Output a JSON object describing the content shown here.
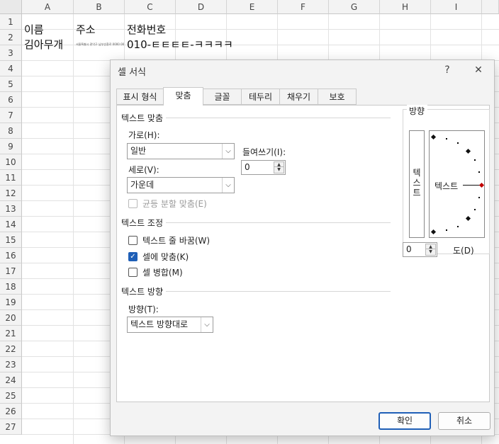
{
  "sheet": {
    "columns": [
      "A",
      "B",
      "C",
      "D",
      "E",
      "F",
      "G",
      "H",
      "I"
    ],
    "rows": [
      "1",
      "2",
      "3",
      "4",
      "5",
      "6",
      "7",
      "8",
      "9",
      "10",
      "11",
      "12",
      "13",
      "14",
      "15",
      "16",
      "17",
      "18",
      "19",
      "20",
      "21",
      "22",
      "23",
      "24",
      "25",
      "26",
      "27"
    ],
    "cells": {
      "a1": "이름",
      "b1": "주소",
      "c1": "전화번호",
      "a2": "김아무개",
      "b2": "서울특별시 관악구 남부순환로 0000 00",
      "c2": "010-ㅌㅌㅌㅌ-ㅋㅋㅋㅋ"
    }
  },
  "dialog": {
    "title": "셀 서식",
    "help_label": "?",
    "close_label": "✕",
    "tabs": [
      {
        "label": "표시 형식"
      },
      {
        "label": "맞춤",
        "active": true
      },
      {
        "label": "글꼴"
      },
      {
        "label": "테두리"
      },
      {
        "label": "채우기"
      },
      {
        "label": "보호"
      }
    ],
    "text_alignment": {
      "header": "텍스트 맞춤",
      "horizontal_label": "가로(H):",
      "horizontal_value": "일반",
      "indent_label": "들여쓰기(I):",
      "indent_value": "0",
      "vertical_label": "세로(V):",
      "vertical_value": "가운데",
      "justify_distributed_label": "균등 분할 맞춤(E)"
    },
    "text_control": {
      "header": "텍스트 조정",
      "wrap_label": "텍스트 줄 바꿈(W)",
      "wrap_checked": false,
      "shrink_label": "셀에 맞춤(K)",
      "shrink_checked": true,
      "merge_label": "셀 병합(M)",
      "merge_checked": false
    },
    "text_direction": {
      "header": "텍스트 방향",
      "direction_label": "방향(T):",
      "direction_value": "텍스트 방향대로"
    },
    "orientation": {
      "header": "방향",
      "vertical_text": "텍\n스\n트",
      "dial_text": "텍스트",
      "degrees_value": "0",
      "degrees_label": "도(D)",
      "dial_degrees": 0
    },
    "buttons": {
      "ok": "확인",
      "cancel": "취소"
    },
    "colors": {
      "accent": "#1f5fb7",
      "dial_marker": "#c00000"
    }
  }
}
